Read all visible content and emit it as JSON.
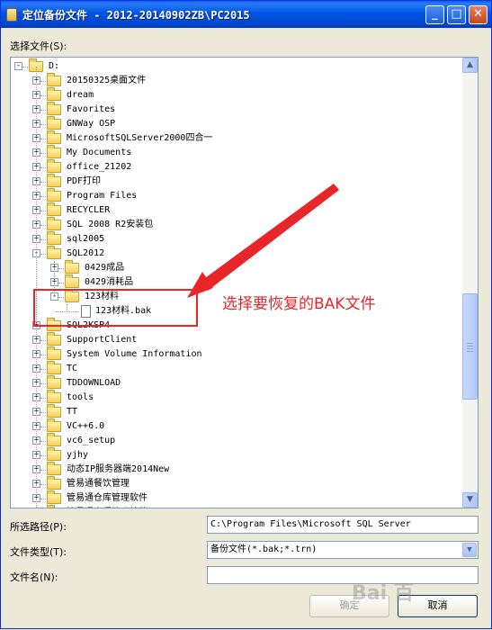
{
  "window": {
    "title": "定位备份文件 - 2012-20140902ZB\\PC2015",
    "minimize_glyph": "_",
    "maximize_glyph": "□",
    "close_glyph": "✕"
  },
  "select_file_label": "选择文件(S):",
  "tree": {
    "items": [
      {
        "label": "D:",
        "level": 0,
        "expander": "−",
        "icon": "folder-icon"
      },
      {
        "label": "20150325桌面文件",
        "level": 1,
        "expander": "+",
        "icon": "folder-icon"
      },
      {
        "label": "dream",
        "level": 1,
        "expander": "+",
        "icon": "folder-icon"
      },
      {
        "label": "Favorites",
        "level": 1,
        "expander": "+",
        "icon": "folder-icon"
      },
      {
        "label": "GNWay OSP",
        "level": 1,
        "expander": "+",
        "icon": "folder-icon"
      },
      {
        "label": "MicrosoftSQLServer2000四合一",
        "level": 1,
        "expander": "+",
        "icon": "folder-icon"
      },
      {
        "label": "My Documents",
        "level": 1,
        "expander": "+",
        "icon": "folder-icon"
      },
      {
        "label": "office_21202",
        "level": 1,
        "expander": "+",
        "icon": "folder-icon"
      },
      {
        "label": "PDF打印",
        "level": 1,
        "expander": "+",
        "icon": "folder-icon"
      },
      {
        "label": "Program Files",
        "level": 1,
        "expander": "+",
        "icon": "folder-icon"
      },
      {
        "label": "RECYCLER",
        "level": 1,
        "expander": "+",
        "icon": "folder-icon"
      },
      {
        "label": "SQL 2008 R2安装包",
        "level": 1,
        "expander": "+",
        "icon": "folder-icon"
      },
      {
        "label": "sql2005",
        "level": 1,
        "expander": "+",
        "icon": "folder-icon"
      },
      {
        "label": "SQL2012",
        "level": 1,
        "expander": "−",
        "icon": "folder-icon"
      },
      {
        "label": "0429成品",
        "level": 2,
        "expander": "+",
        "icon": "folder-icon"
      },
      {
        "label": "0429消耗品",
        "level": 2,
        "expander": "+",
        "icon": "folder-icon"
      },
      {
        "label": "123材料",
        "level": 2,
        "expander": "−",
        "icon": "folder-icon"
      },
      {
        "label": "123材料.bak",
        "level": 3,
        "expander": "",
        "icon": "file-icon"
      },
      {
        "label": "SQL2KSP4",
        "level": 1,
        "expander": "+",
        "icon": "folder-icon"
      },
      {
        "label": "SupportClient",
        "level": 1,
        "expander": "+",
        "icon": "folder-icon"
      },
      {
        "label": "System Volume Information",
        "level": 1,
        "expander": "+",
        "icon": "folder-icon"
      },
      {
        "label": "TC",
        "level": 1,
        "expander": "+",
        "icon": "folder-icon"
      },
      {
        "label": "TDDOWNLOAD",
        "level": 1,
        "expander": "+",
        "icon": "folder-icon"
      },
      {
        "label": "tools",
        "level": 1,
        "expander": "+",
        "icon": "folder-icon"
      },
      {
        "label": "TT",
        "level": 1,
        "expander": "+",
        "icon": "folder-icon"
      },
      {
        "label": "VC++6.0",
        "level": 1,
        "expander": "+",
        "icon": "folder-icon"
      },
      {
        "label": "vc6_setup",
        "level": 1,
        "expander": "+",
        "icon": "folder-icon"
      },
      {
        "label": "yjhy",
        "level": 1,
        "expander": "+",
        "icon": "folder-icon"
      },
      {
        "label": "动态IP服务器端2014New",
        "level": 1,
        "expander": "+",
        "icon": "folder-icon"
      },
      {
        "label": "管易通餐饮管理",
        "level": 1,
        "expander": "+",
        "icon": "folder-icon"
      },
      {
        "label": "管易通仓库管理软件",
        "level": 1,
        "expander": "+",
        "icon": "folder-icon"
      },
      {
        "label": "管易通商贸管理软件",
        "level": 1,
        "expander": "+",
        "icon": "folder-icon"
      }
    ],
    "scroll_up_glyph": "▲",
    "scroll_down_glyph": "▼"
  },
  "annotation": {
    "text": "选择要恢复的BAK文件",
    "color": "#e8262a"
  },
  "path": {
    "label": "所选路径(P):",
    "value": "C:\\Program Files\\Microsoft SQL Server"
  },
  "file_type": {
    "label": "文件类型(T):",
    "value": "备份文件(*.bak;*.trn)",
    "arrow_glyph": "▼"
  },
  "file_name": {
    "label": "文件名(N):",
    "value": ""
  },
  "buttons": {
    "ok": "确定",
    "cancel": "取消"
  },
  "watermark": "Bai 百"
}
